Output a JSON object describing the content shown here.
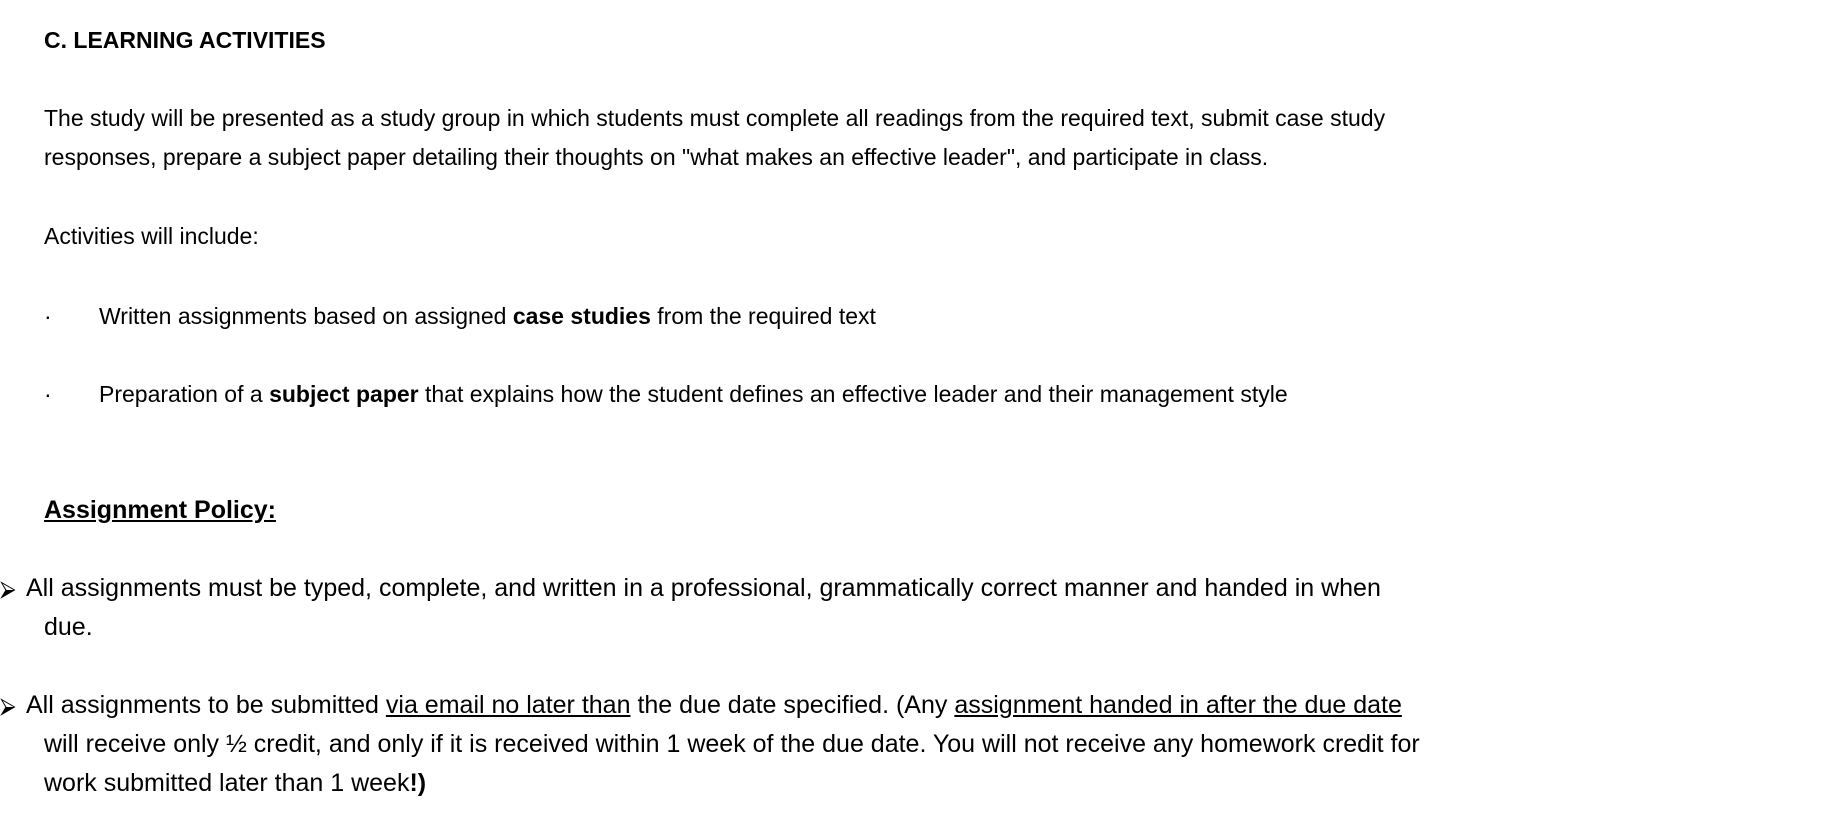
{
  "section": {
    "heading": "C. LEARNING ACTIVITIES",
    "intro_line1": "The study will be presented as a study group in which students must complete all readings from the required text, submit case study",
    "intro_line2": "responses, prepare a subject paper detailing their thoughts on \"what makes an effective leader\", and participate in class.",
    "activities_intro": "Activities will include:",
    "bullet_char": "·",
    "activities": [
      {
        "pre": "Written assignments based on assigned ",
        "bold": "case studies",
        "post": " from the required text"
      },
      {
        "pre": "Preparation of a ",
        "bold": "subject paper",
        "post": " that explains how the student defines an effective leader and their management style"
      }
    ]
  },
  "policy": {
    "title": "Assignment Policy:",
    "arrow_icon": "arrow-bullet-icon",
    "arrow_char": "⮚",
    "items": [
      {
        "line1": "All assignments must be typed, complete, and written in a professional, grammatically correct manner and handed in when",
        "line2": "due."
      },
      {
        "line1_a": "All assignments to be submitted ",
        "line1_u1": "via email no later than",
        "line1_b": " the due date specified. (Any ",
        "line1_u2": "assignment handed in after the due date",
        "line2": "will receive only ½ credit, and only if it is received within 1 week of the due date. You will not receive any homework credit for",
        "line3_a": "work submitted later than 1 week",
        "line3_bold": "!)"
      }
    ]
  }
}
